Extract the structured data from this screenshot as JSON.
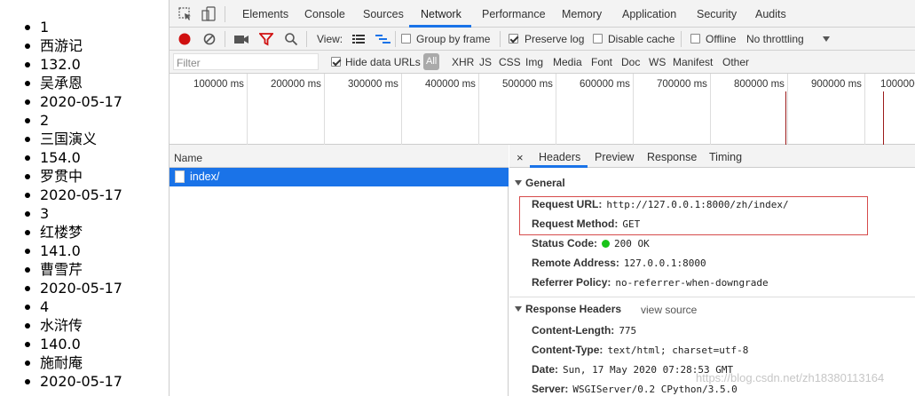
{
  "page": {
    "items": [
      "1",
      "西游记",
      "132.0",
      "吴承恩",
      "2020-05-17",
      "2",
      "三国演义",
      "154.0",
      "罗贯中",
      "2020-05-17",
      "3",
      "红楼梦",
      "141.0",
      "曹雪芹",
      "2020-05-17",
      "4",
      "水浒传",
      "140.0",
      "施耐庵",
      "2020-05-17"
    ]
  },
  "tabs": [
    "Elements",
    "Console",
    "Sources",
    "Network",
    "Performance",
    "Memory",
    "Application",
    "Security",
    "Audits"
  ],
  "toolbar": {
    "view_label": "View:",
    "group_by_frame": "Group by frame",
    "preserve_log": "Preserve log",
    "disable_cache": "Disable cache",
    "offline": "Offline",
    "throttling": "No throttling"
  },
  "filter": {
    "placeholder": "Filter",
    "hide_data_urls": "Hide data URLs",
    "types": [
      "All",
      "XHR",
      "JS",
      "CSS",
      "Img",
      "Media",
      "Font",
      "Doc",
      "WS",
      "Manifest",
      "Other"
    ]
  },
  "timeline": {
    "ticks": [
      "100000 ms",
      "200000 ms",
      "300000 ms",
      "400000 ms",
      "500000 ms",
      "600000 ms",
      "700000 ms",
      "800000 ms",
      "900000 ms",
      "1000000"
    ]
  },
  "requests": {
    "column": "Name",
    "rows": [
      "index/"
    ]
  },
  "details": {
    "close": "×",
    "tabs": [
      "Headers",
      "Preview",
      "Response",
      "Timing"
    ],
    "general_title": "General",
    "request_url_key": "Request URL:",
    "request_url": "http://127.0.0.1:8000/zh/index/",
    "request_method_key": "Request Method:",
    "request_method": "GET",
    "status_code_key": "Status Code:",
    "status_code": "200 OK",
    "remote_address_key": "Remote Address:",
    "remote_address": "127.0.0.1:8000",
    "referrer_policy_key": "Referrer Policy:",
    "referrer_policy": "no-referrer-when-downgrade",
    "response_headers_title": "Response Headers",
    "view_source": "view source",
    "content_length_key": "Content-Length:",
    "content_length": "775",
    "content_type_key": "Content-Type:",
    "content_type": "text/html; charset=utf-8",
    "date_key": "Date:",
    "date": "Sun, 17 May 2020 07:28:53 GMT",
    "server_key": "Server:",
    "server": "WSGIServer/0.2 CPython/3.5.0"
  },
  "watermark": "https://blog.csdn.net/zh18380113164",
  "colors": {
    "accent": "#1a73e8",
    "record": "#d01010",
    "filter_icon": "#d01010",
    "status_ok": "#19c319"
  }
}
